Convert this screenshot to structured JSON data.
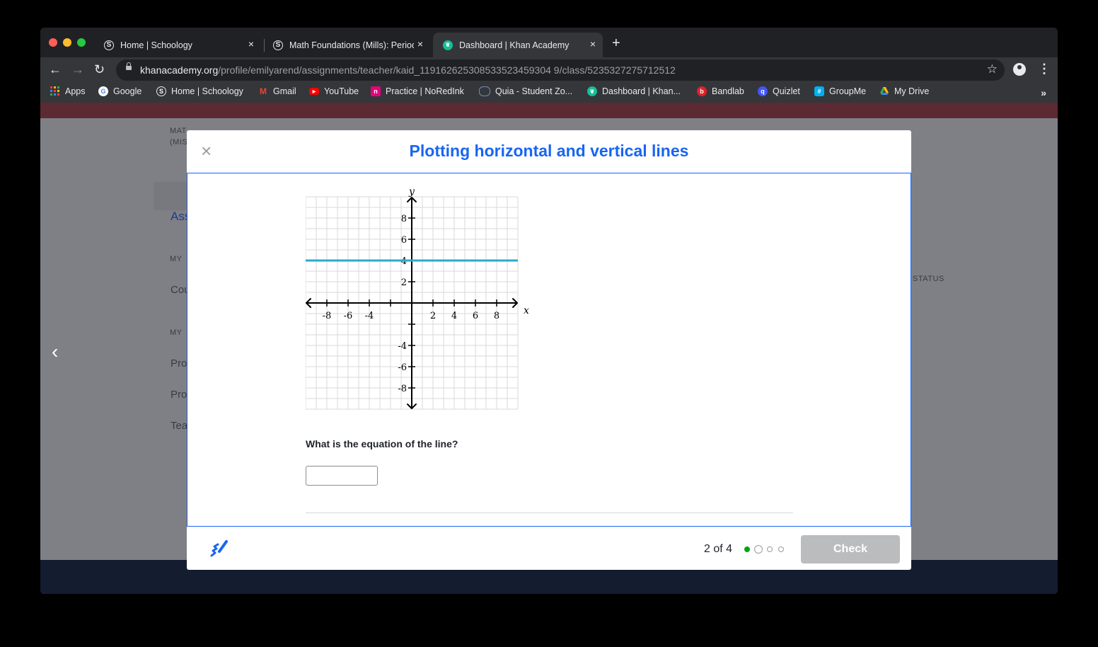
{
  "browser": {
    "tabs": [
      {
        "title": "Home | Schoology",
        "close": "×"
      },
      {
        "title": "Math Foundations (Mills): Period",
        "close": "×"
      },
      {
        "title": "Dashboard | Khan Academy",
        "close": "×"
      }
    ],
    "new_tab": "+",
    "url_host": "khanacademy.org",
    "url_path": "/profile/emilyarend/assignments/teacher/kaid_119162625308533523459304 9/class/5235327275712512",
    "bookmarks": [
      "Apps",
      "Google",
      "Home | Schoology",
      "Gmail",
      "YouTube",
      "Practice | NoRedInk",
      "Quia - Student Zo...",
      "Dashboard | Khan...",
      "Bandlab",
      "Quizlet",
      "GroupMe",
      "My Drive"
    ],
    "bookmarks_more": "»"
  },
  "background": {
    "labels": [
      "MAT",
      "(MIS",
      "Ass",
      "MY",
      "Cou",
      "MY",
      "Pro",
      "Pro",
      "Tea",
      "STATUS"
    ]
  },
  "modal": {
    "close": "×",
    "title": "Plotting horizontal and vertical lines",
    "question": "What is the equation of the line?",
    "answer_value": "",
    "progress": "2 of 4",
    "check_label": "Check"
  },
  "graph": {
    "x_axis_label": "x",
    "y_axis_label": "y",
    "x_range": [
      -10,
      10
    ],
    "y_range": [
      -10,
      10
    ],
    "x_tick_labels": [
      "-8",
      "-6",
      "-4",
      "2",
      "4",
      "6",
      "8"
    ],
    "y_tick_labels": [
      "8",
      "6",
      "4",
      "2",
      "-4",
      "-6",
      "-8"
    ],
    "line": {
      "type": "horizontal",
      "y": 4,
      "color": "#29abca"
    }
  },
  "colors": {
    "title": "#1865f2",
    "progress_done": "#00a60e",
    "check_disabled": "#bbbcbe"
  }
}
